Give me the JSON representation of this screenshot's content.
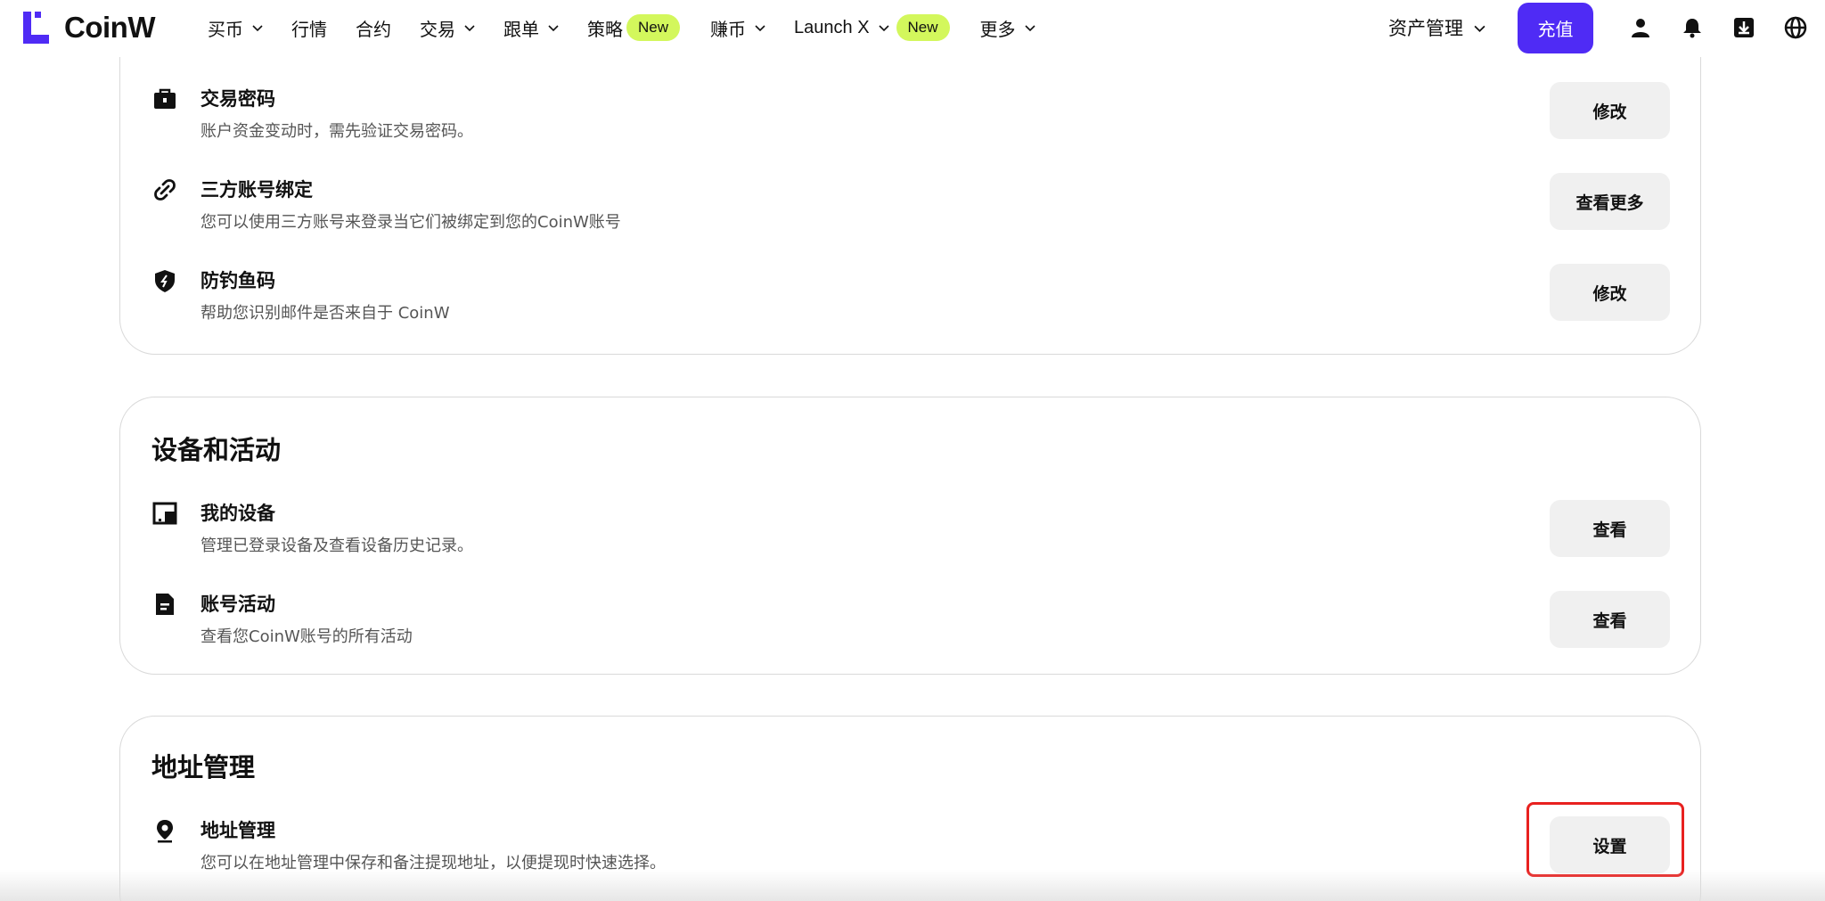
{
  "brand": {
    "name": "CoinW",
    "color": "#4f2bf5"
  },
  "nav": {
    "items": [
      {
        "label": "买币",
        "has_dropdown": true
      },
      {
        "label": "行情",
        "has_dropdown": false
      },
      {
        "label": "合约",
        "has_dropdown": false
      },
      {
        "label": "交易",
        "has_dropdown": true
      },
      {
        "label": "跟单",
        "has_dropdown": true
      },
      {
        "label": "策略",
        "has_dropdown": false,
        "badge": "New"
      },
      {
        "label": "赚币",
        "has_dropdown": true
      },
      {
        "label": "Launch X",
        "has_dropdown": true,
        "badge": "New"
      },
      {
        "label": "更多",
        "has_dropdown": true
      }
    ],
    "asset_menu": "资产管理",
    "deposit_label": "充值",
    "icons": [
      "user-icon",
      "bell-icon",
      "download-icon",
      "globe-icon"
    ]
  },
  "security": {
    "rows": [
      {
        "title": "交易密码",
        "desc": "账户资金变动时，需先验证交易密码。",
        "button": "修改",
        "icon": "briefcase-lock-icon"
      },
      {
        "title": "三方账号绑定",
        "desc": "您可以使用三方账号来登录当它们被绑定到您的CoinW账号",
        "button": "查看更多",
        "icon": "link-icon"
      },
      {
        "title": "防钓鱼码",
        "desc": "帮助您识别邮件是否来自于 CoinW",
        "button": "修改",
        "icon": "shield-icon"
      }
    ]
  },
  "devices": {
    "title": "设备和活动",
    "rows": [
      {
        "title": "我的设备",
        "desc": "管理已登录设备及查看设备历史记录。",
        "button": "查看",
        "icon": "device-icon"
      },
      {
        "title": "账号活动",
        "desc": "查看您CoinW账号的所有活动",
        "button": "查看",
        "icon": "document-icon"
      }
    ]
  },
  "address": {
    "title": "地址管理",
    "rows": [
      {
        "title": "地址管理",
        "desc": "您可以在地址管理中保存和备注提现地址，以便提现时快速选择。",
        "button": "设置",
        "icon": "location-pin-icon"
      }
    ]
  },
  "colors": {
    "badge_new": "#d3f75c",
    "highlight": "#e8211f",
    "button_bg": "#f0f0f0"
  }
}
